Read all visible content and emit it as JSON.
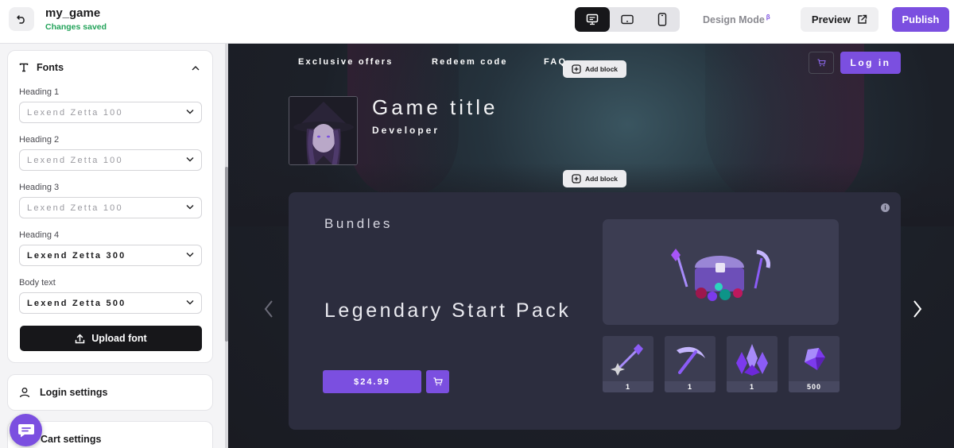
{
  "topbar": {
    "project_name": "my_game",
    "status": "Changes saved",
    "design_mode": "Design Mode",
    "design_mode_badge": "β",
    "preview_label": "Preview",
    "publish_label": "Publish",
    "devices": [
      "desktop-icon",
      "tablet-icon",
      "mobile-icon"
    ],
    "active_device": "desktop"
  },
  "sidebar": {
    "fonts_panel": {
      "title": "Fonts",
      "heading1_label": "Heading 1",
      "heading1_value": "Lexend Zetta 100",
      "heading2_label": "Heading 2",
      "heading2_value": "Lexend Zetta 100",
      "heading3_label": "Heading 3",
      "heading3_value": "Lexend Zetta 100",
      "heading4_label": "Heading 4",
      "heading4_value": "Lexend Zetta 300",
      "body_label": "Body text",
      "body_value": "Lexend Zetta 500",
      "upload_label": "Upload font"
    },
    "login_settings": "Login settings",
    "cart_settings": "Cart settings"
  },
  "canvas": {
    "nav": {
      "exclusive_offers": "Exclusive offers",
      "redeem_code": "Redeem code",
      "faq": "FAQ",
      "login_label": "Log in"
    },
    "add_block_label": "Add block",
    "hero": {
      "title": "Game title",
      "developer": "Developer"
    },
    "bundle": {
      "section_title": "Bundles",
      "name": "Legendary Start Pack",
      "price": "$24.99",
      "items": [
        {
          "icon": "wand-icon",
          "qty": "1"
        },
        {
          "icon": "pickaxe-icon",
          "qty": "1"
        },
        {
          "icon": "crystals-icon",
          "qty": "1"
        },
        {
          "icon": "gem-icon",
          "qty": "500"
        }
      ]
    }
  },
  "colors": {
    "accent": "#7b4fe0",
    "saved_green": "#23a35a",
    "card_bg": "#2c2d3e",
    "tile_bg": "#3c3d52"
  }
}
